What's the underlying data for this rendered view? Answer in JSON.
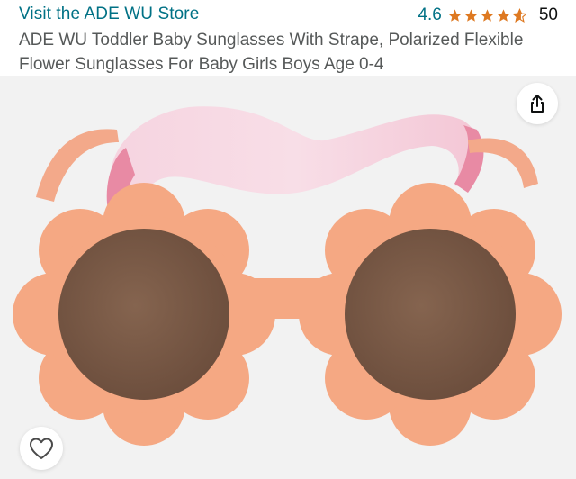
{
  "header": {
    "store_link": "Visit the ADE WU Store",
    "rating_value": "4.6",
    "rating_stars": 4.6,
    "rating_count": "50",
    "title": "ADE WU Toddler Baby Sunglasses With Strape, Polarized Flexible Flower Sunglasses For Baby Girls Boys Age 0-4"
  },
  "media": {
    "icons": {
      "share": "share-icon",
      "wishlist": "heart-icon"
    }
  },
  "colors": {
    "link": "#007185",
    "star": "#de7921",
    "frame": "#f2a27a",
    "lens": "#7a5a48",
    "strap": "#f3c9d8",
    "strap_dark": "#e9859f"
  }
}
